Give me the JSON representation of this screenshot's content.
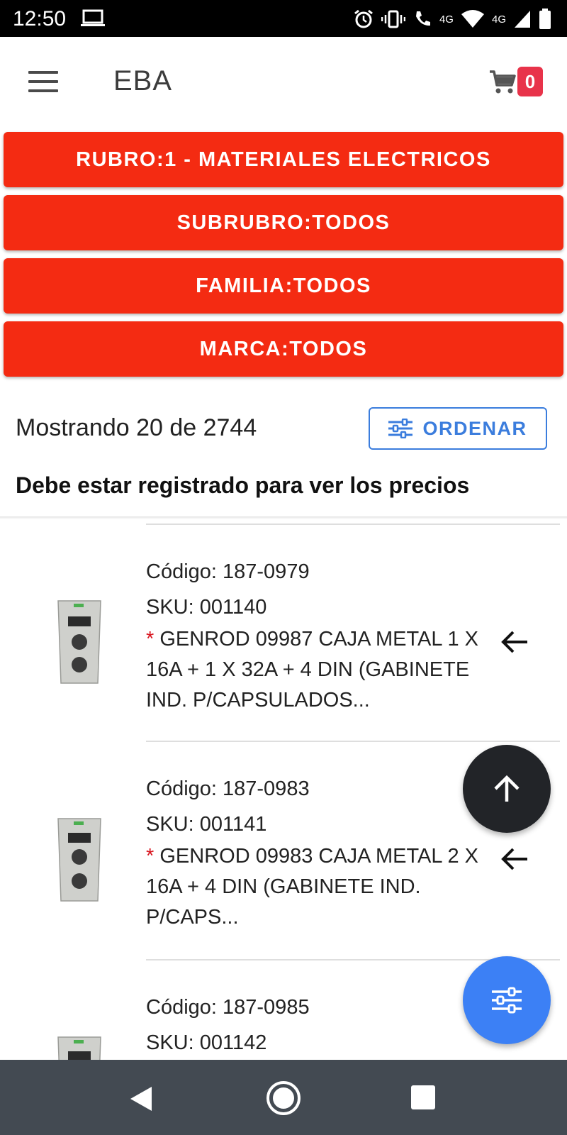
{
  "status_bar": {
    "time": "12:50",
    "network_label": "4G",
    "network_label_2": "4G"
  },
  "app_bar": {
    "title": "EBA",
    "cart_count": "0"
  },
  "filters": [
    {
      "label": "RUBRO:1 - MATERIALES ELECTRICOS"
    },
    {
      "label": "SUBRUBRO:TODOS"
    },
    {
      "label": "FAMILIA:TODOS"
    },
    {
      "label": "MARCA:TODOS"
    }
  ],
  "results": {
    "count_text": "Mostrando 20 de 2744",
    "order_label": "ORDENAR"
  },
  "notice": "Debe estar registrado para ver los precios",
  "products": [
    {
      "codigo": "Código: 187-0979",
      "sku": "SKU: 001140",
      "star": "*",
      "desc_1": "GENROD 09987 CAJA METAL 1 X",
      "desc_2": "16A + 1 X 32A + 4 DIN (GABINETE",
      "desc_3": "IND. P/CAPSULADOS..."
    },
    {
      "codigo": "Código: 187-0983",
      "sku": "SKU: 001141",
      "star": "*",
      "desc_1": "GENROD 09983 CAJA METAL 2 X",
      "desc_2": "16A + 4 DIN (GABINETE IND.",
      "desc_3": "P/CAPS..."
    },
    {
      "codigo": "Código: 187-0985",
      "sku": "SKU: 001142"
    }
  ],
  "colors": {
    "filter_red": "#f42b12",
    "accent_blue": "#3b7ddd",
    "fab_dark": "#222428",
    "fab_blue": "#3c80f5",
    "badge_red": "#e8334a",
    "nav_bar": "#434a52"
  }
}
